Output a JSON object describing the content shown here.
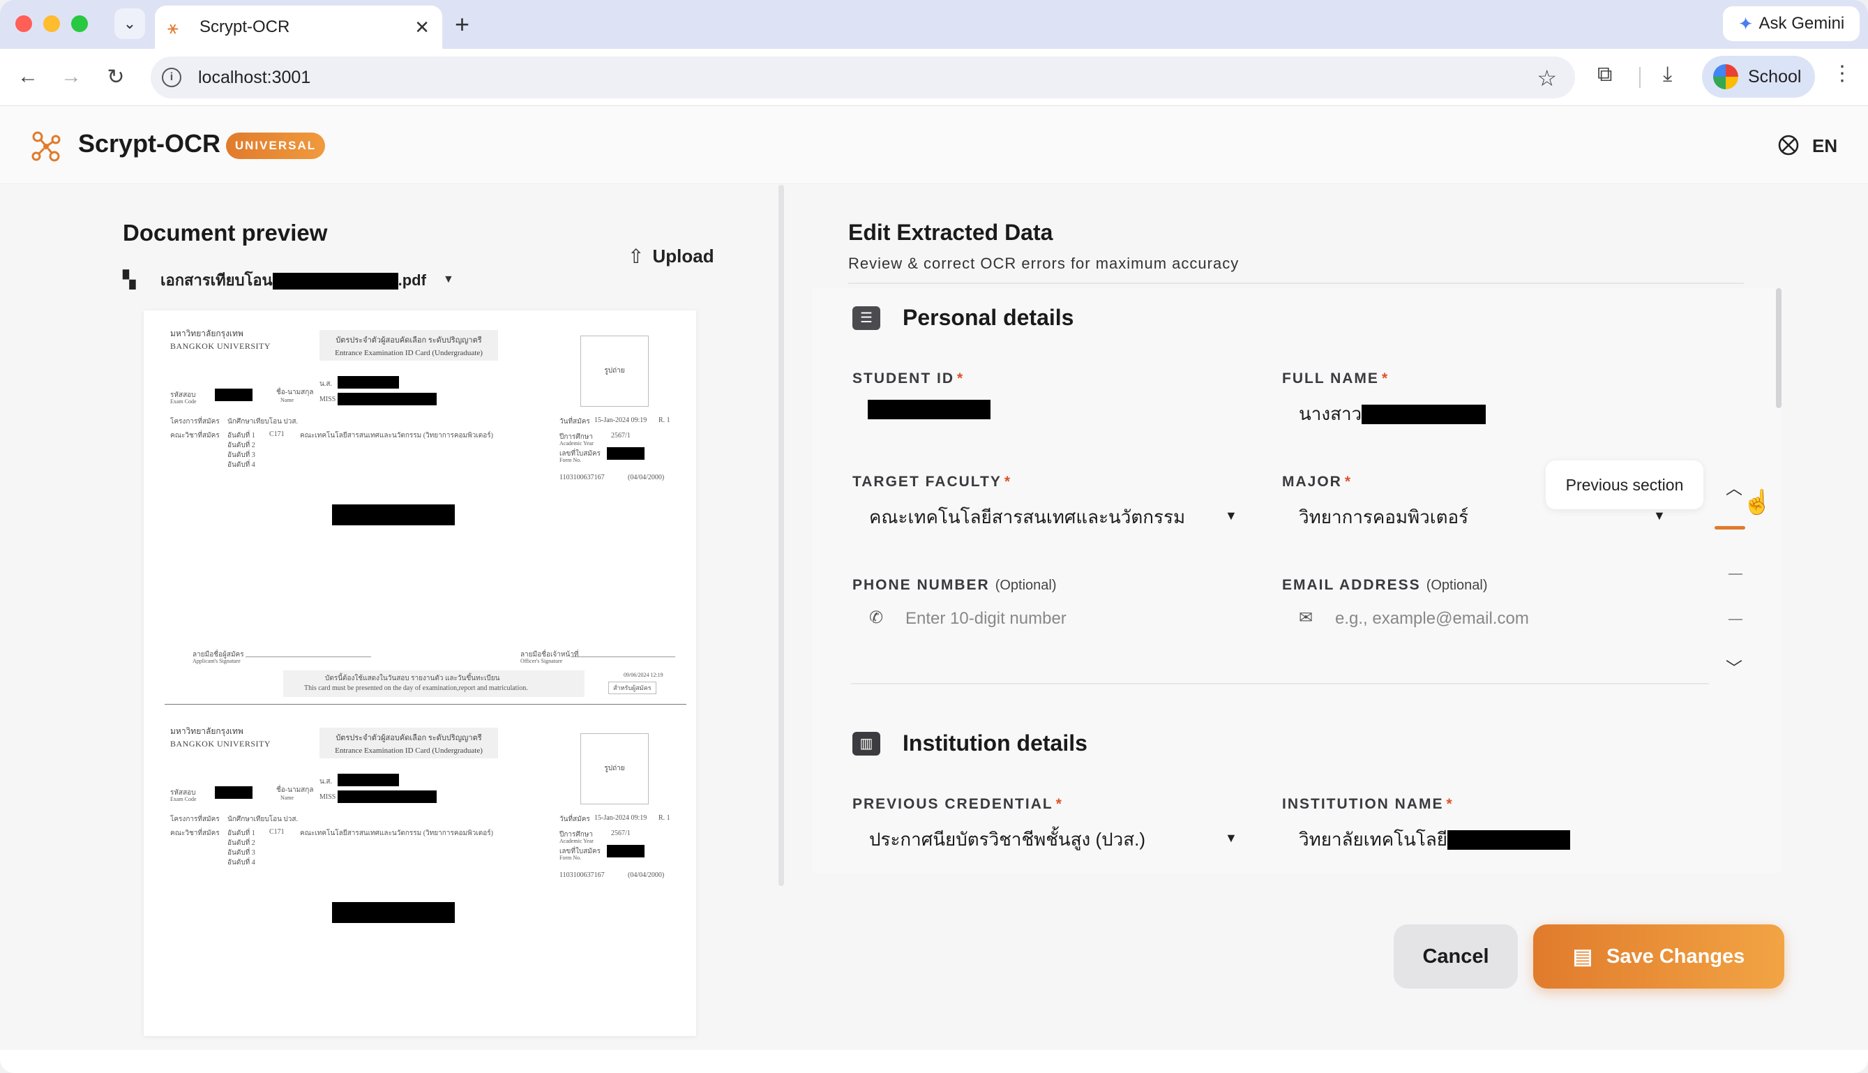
{
  "browser": {
    "tab_title": "Scrypt-OCR",
    "url": "localhost:3001",
    "ask_gemini": "Ask Gemini",
    "profile_label": "School"
  },
  "app": {
    "brand": "Scrypt-OCR",
    "badge": "UNIVERSAL",
    "language": "EN",
    "accent_color": "#e07b2c"
  },
  "preview": {
    "title": "Document preview",
    "file_name_prefix": "เอกสารเทียบโอน",
    "file_name_suffix": ".pdf",
    "upload_label": "Upload",
    "card": {
      "university_th": "มหาวิทยาลัยกรุงเทพ",
      "university_en": "BANGKOK UNIVERSITY",
      "header_th": "บัตรประจำตัวผู้สอบคัดเลือก ระดับปริญญาตรี",
      "header_en": "Entrance Examination ID Card (Undergraduate)",
      "photo_label": "รูปถ่าย",
      "exam_code_label": "รหัสสอบ",
      "exam_code_en": "Exam Code",
      "name_label": "ชื่อ-นามสกุล",
      "name_en": "Name",
      "title_th": "น.ส.",
      "title_en": "MISS",
      "program_label": "โครงการที่สมัคร",
      "program_value": "นักศึกษาเทียบโอน ปวส.",
      "faculty_label": "คณะวิชาที่สมัคร",
      "choice_1": "อันดับที่ 1",
      "choice_2": "อันดับที่ 2",
      "choice_3": "อันดับที่ 3",
      "choice_4": "อันดับที่ 4",
      "faculty_code": "C171",
      "faculty_value": "คณะเทคโนโลยีสารสนเทศและนวัตกรรม (วิทยาการคอมพิวเตอร์)",
      "apply_date_label": "วันที่สมัคร",
      "apply_date": "15-Jan-2024 09:19",
      "round": "R. 1",
      "academic_year_label": "ปีการศึกษา",
      "academic_year_en": "Academic Year",
      "academic_year": "2567/1",
      "form_no_label": "เลขที่ใบสมัคร",
      "form_no_en": "Form No.",
      "id_number": "1103100637167",
      "dob": "(04/04/2000)",
      "applicant_sig": "ลายมือชื่อผู้สมัคร",
      "applicant_sig_en": "Applicant's Signature",
      "officer_sig": "ลายมือชื่อเจ้าหน้าที่",
      "officer_sig_en": "Officer's Signature",
      "print_date": "09/06/2024 12:19",
      "notice_th": "บัตรนี้ต้องใช้แสดงในวันสอบ รายงานตัว และวันขึ้นทะเบียน",
      "notice_en": "This card must be presented on the day of examination,report and matriculation.",
      "copy_label": "สำหรับผู้สมัคร"
    }
  },
  "form": {
    "title": "Edit Extracted Data",
    "subtitle": "Review & correct OCR errors for maximum accuracy",
    "personal": {
      "title": "Personal details",
      "student_id_label": "STUDENT ID",
      "full_name_label": "FULL NAME",
      "full_name_prefix": "นางสาว",
      "target_faculty_label": "TARGET FACULTY",
      "target_faculty_value": "คณะเทคโนโลยีสารสนเทศและนวัตกรรม",
      "major_label": "MAJOR",
      "major_value": "วิทยาการคอมพิวเตอร์",
      "phone_label": "PHONE NUMBER",
      "phone_optional": "(Optional)",
      "phone_placeholder": "Enter 10-digit number",
      "email_label": "EMAIL ADDRESS",
      "email_optional": "(Optional)",
      "email_placeholder": "e.g., example@email.com"
    },
    "institution": {
      "title": "Institution details",
      "credential_label": "PREVIOUS CREDENTIAL",
      "credential_value": "ประกาศนียบัตรวิชาชีพชั้นสูง (ปวส.)",
      "institution_label": "INSTITUTION NAME",
      "institution_prefix": "วิทยาลัยเทคโนโลยี"
    },
    "required_mark": "*"
  },
  "section_nav": {
    "tooltip": "Previous section"
  },
  "actions": {
    "cancel": "Cancel",
    "save": "Save Changes"
  }
}
